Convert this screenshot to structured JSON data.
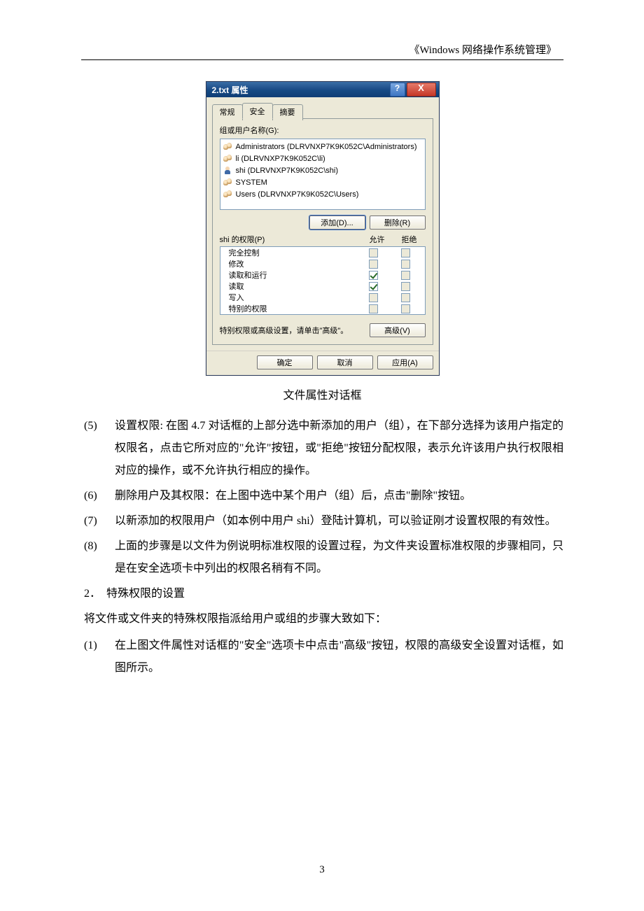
{
  "header": "《Windows 网络操作系统管理》",
  "dialog": {
    "title": "2.txt 属性",
    "help": "?",
    "close": "X",
    "tabs": {
      "general": "常规",
      "security": "安全",
      "summary": "摘要"
    },
    "group_label": "组或用户名称(G):",
    "users": [
      "Administrators (DLRVNXP7K9K052C\\Administrators)",
      "li (DLRVNXP7K9K052C\\li)",
      "shi (DLRVNXP7K9K052C\\shi)",
      "SYSTEM",
      "Users (DLRVNXP7K9K052C\\Users)"
    ],
    "add_btn": "添加(D)...",
    "remove_btn": "删除(R)",
    "perm_header": {
      "name": "shi 的权限(P)",
      "allow": "允许",
      "deny": "拒绝"
    },
    "perms": [
      {
        "name": "完全控制",
        "allow": "off",
        "deny": "off"
      },
      {
        "name": "修改",
        "allow": "off",
        "deny": "off"
      },
      {
        "name": "读取和运行",
        "allow": "on",
        "deny": "off"
      },
      {
        "name": "读取",
        "allow": "on",
        "deny": "off"
      },
      {
        "name": "写入",
        "allow": "off",
        "deny": "off"
      },
      {
        "name": "特别的权限",
        "allow": "off",
        "deny": "off"
      }
    ],
    "adv_text": "特别权限或高级设置，请单击\"高级\"。",
    "adv_btn": "高级(V)",
    "ok": "确定",
    "cancel": "取消",
    "apply": "应用(A)"
  },
  "caption": "文件属性对话框",
  "items": {
    "n5": "(5)",
    "t5": "设置权限: 在图 4.7 对话框的上部分选中新添加的用户（组），在下部分选择为该用户指定的权限名，点击它所对应的\"允许\"按钮，或\"拒绝\"按钮分配权限，表示允许该用户执行权限相对应的操作，或不允许执行相应的操作。",
    "n6": "(6)",
    "t6": "删除用户及其权限：在上图中选中某个用户（组）后，点击\"删除\"按钮。",
    "n7": "(7)",
    "t7": "以新添加的权限用户（如本例中用户 shi）登陆计算机，可以验证刚才设置权限的有效性。",
    "n8": "(8)",
    "t8": "上面的步骤是以文件为例说明标准权限的设置过程，为文件夹设置标准权限的步骤相同，只是在安全选项卡中列出的权限名稍有不同。"
  },
  "section": {
    "num": "2．",
    "title": "特殊权限的设置"
  },
  "para": "将文件或文件夹的特殊权限指派给用户或组的步骤大致如下：",
  "step1": {
    "num": "(1)",
    "text": "在上图文件属性对话框的\"安全\"选项卡中点击\"高级\"按钮，权限的高级安全设置对话框，如图所示。"
  },
  "page_number": "3"
}
